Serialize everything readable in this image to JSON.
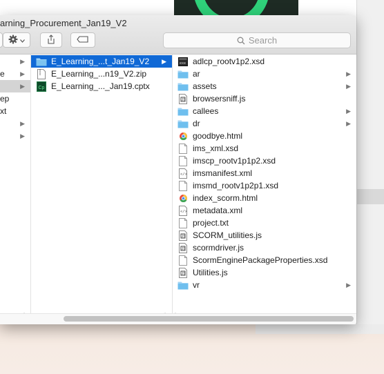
{
  "window": {
    "title": "arning_Procurement_Jan19_V2"
  },
  "toolbar": {
    "search_placeholder": "Search"
  },
  "column1": {
    "items": [
      {
        "label": "",
        "chevron": "▶"
      },
      {
        "label": "e",
        "chevron": "▶"
      },
      {
        "label": "",
        "chevron": "▶"
      },
      {
        "label": "ep",
        "chevron": ""
      },
      {
        "label": "xt",
        "chevron": ""
      },
      {
        "label": "",
        "chevron": "▶"
      },
      {
        "label": "",
        "chevron": "▶"
      }
    ]
  },
  "column2": {
    "items": [
      {
        "label": "E_Learning_...t_Jan19_V2",
        "icon": "folder-icon",
        "chevron": "▶"
      },
      {
        "label": "E_Learning_...n19_V2.zip",
        "icon": "zip-file-icon",
        "chevron": ""
      },
      {
        "label": "E_Learning_..._Jan19.cptx",
        "icon": "captivate-file-icon",
        "chevron": ""
      }
    ]
  },
  "column3": {
    "items": [
      {
        "label": "adlcp_rootv1p2.xsd",
        "icon": "xsd-file-icon",
        "chevron": ""
      },
      {
        "label": "ar",
        "icon": "folder-icon",
        "chevron": "▶"
      },
      {
        "label": "assets",
        "icon": "folder-icon",
        "chevron": "▶"
      },
      {
        "label": "browsersniff.js",
        "icon": "js-file-icon",
        "chevron": ""
      },
      {
        "label": "callees",
        "icon": "folder-icon",
        "chevron": "▶"
      },
      {
        "label": "dr",
        "icon": "folder-icon",
        "chevron": "▶"
      },
      {
        "label": "goodbye.html",
        "icon": "html-file-icon",
        "chevron": ""
      },
      {
        "label": "ims_xml.xsd",
        "icon": "document-icon",
        "chevron": ""
      },
      {
        "label": "imscp_rootv1p1p2.xsd",
        "icon": "document-icon",
        "chevron": ""
      },
      {
        "label": "imsmanifest.xml",
        "icon": "xml-file-icon",
        "chevron": ""
      },
      {
        "label": "imsmd_rootv1p2p1.xsd",
        "icon": "document-icon",
        "chevron": ""
      },
      {
        "label": "index_scorm.html",
        "icon": "html-file-icon",
        "chevron": ""
      },
      {
        "label": "metadata.xml",
        "icon": "xml-file-icon",
        "chevron": ""
      },
      {
        "label": "project.txt",
        "icon": "document-icon",
        "chevron": ""
      },
      {
        "label": "SCORM_utilities.js",
        "icon": "js-file-icon",
        "chevron": ""
      },
      {
        "label": "scormdriver.js",
        "icon": "js-file-icon",
        "chevron": ""
      },
      {
        "label": "ScormEnginePackageProperties.xsd",
        "icon": "document-icon",
        "chevron": ""
      },
      {
        "label": "Utilities.js",
        "icon": "js-file-icon",
        "chevron": ""
      },
      {
        "label": "vr",
        "icon": "folder-icon",
        "chevron": "▶"
      }
    ]
  },
  "colors": {
    "selection": "#1069d6",
    "folder": "#5eb6ea",
    "background_accent": "#2fd27a"
  }
}
